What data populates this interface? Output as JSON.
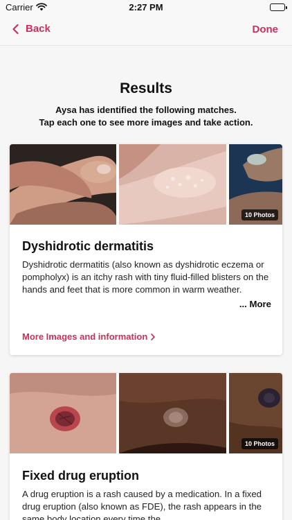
{
  "status_bar": {
    "carrier": "Carrier",
    "time": "2:27 PM"
  },
  "nav": {
    "back_label": "Back",
    "done_label": "Done"
  },
  "colors": {
    "accent": "#c8305c",
    "background": "#f7f6f6"
  },
  "results": {
    "title": "Results",
    "subtitle_line1": "Aysa has identified the following matches.",
    "subtitle_line2": "Tap each one to see more images and take action."
  },
  "conditions": [
    {
      "title": "Dyshidrotic dermatitis",
      "photo_count": "10 Photos",
      "description": "Dyshidrotic dermatitis (also known as dyshidrotic eczema or pompholyx) is an itchy rash with tiny fluid-filled blisters on the hands and feet that is more common in warm weather.",
      "more_label": "... More",
      "link_label": "More Images and information"
    },
    {
      "title": "Fixed drug eruption",
      "photo_count": "10 Photos",
      "description": "A drug eruption is a rash caused by a medication. In a fixed drug eruption (also known as FDE), the rash appears in the same body location every time the"
    }
  ]
}
